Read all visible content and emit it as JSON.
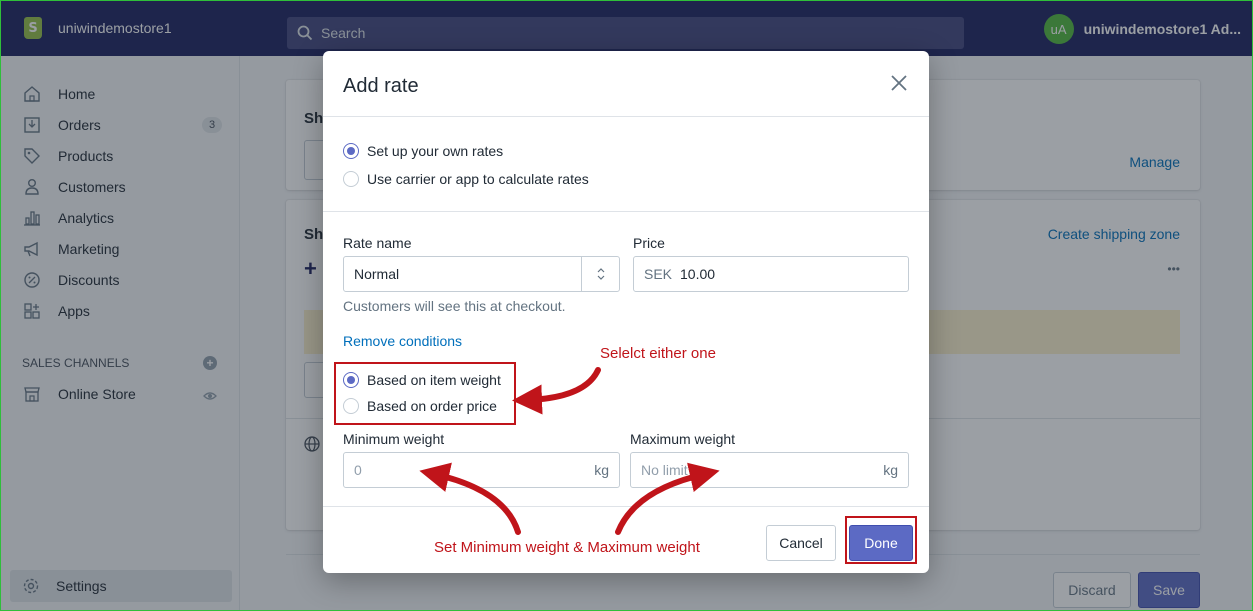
{
  "topbar": {
    "store_name": "uniwindemostore1",
    "search_placeholder": "Search",
    "user_initials": "uA",
    "user_name": "uniwindemostore1 Ad..."
  },
  "sidebar": {
    "items": [
      {
        "label": "Home",
        "icon": "home-icon"
      },
      {
        "label": "Orders",
        "icon": "orders-icon",
        "badge": "3"
      },
      {
        "label": "Products",
        "icon": "tag-icon"
      },
      {
        "label": "Customers",
        "icon": "person-icon"
      },
      {
        "label": "Analytics",
        "icon": "bar-chart-icon"
      },
      {
        "label": "Marketing",
        "icon": "megaphone-icon"
      },
      {
        "label": "Discounts",
        "icon": "discount-icon"
      },
      {
        "label": "Apps",
        "icon": "apps-icon"
      }
    ],
    "sales_channels_label": "SALES CHANNELS",
    "online_store_label": "Online Store",
    "settings_label": "Settings"
  },
  "background": {
    "manage_link": "Manage",
    "create_zone_link": "Create shipping zone",
    "more_label": "•••",
    "heading_1": "Sh",
    "heading_2": "Sh",
    "discard_label": "Discard",
    "save_label": "Save"
  },
  "modal": {
    "title": "Add rate",
    "rate_type_options": [
      {
        "label": "Set up your own rates",
        "checked": true
      },
      {
        "label": "Use carrier or app to calculate rates",
        "checked": false
      }
    ],
    "rate_name_label": "Rate name",
    "rate_name_value": "Normal",
    "price_label": "Price",
    "price_currency": "SEK",
    "price_value": "10.00",
    "rate_name_help": "Customers will see this at checkout.",
    "remove_conditions_link": "Remove conditions",
    "condition_options": [
      {
        "label": "Based on item weight",
        "checked": true
      },
      {
        "label": "Based on order price",
        "checked": false
      }
    ],
    "min_weight_label": "Minimum weight",
    "min_weight_placeholder": "0",
    "min_weight_unit": "kg",
    "max_weight_label": "Maximum weight",
    "max_weight_placeholder": "No limit",
    "max_weight_unit": "kg",
    "cancel_label": "Cancel",
    "done_label": "Done"
  },
  "annotations": {
    "select_either": "Selelct either one",
    "set_weights": "Set Minimum weight & Maximum weight",
    "color": "#c0141a"
  },
  "colors": {
    "topbar": "#1c2260",
    "accent": "#5c6ac4",
    "link": "#006fbb",
    "annotation": "#c0141a"
  }
}
